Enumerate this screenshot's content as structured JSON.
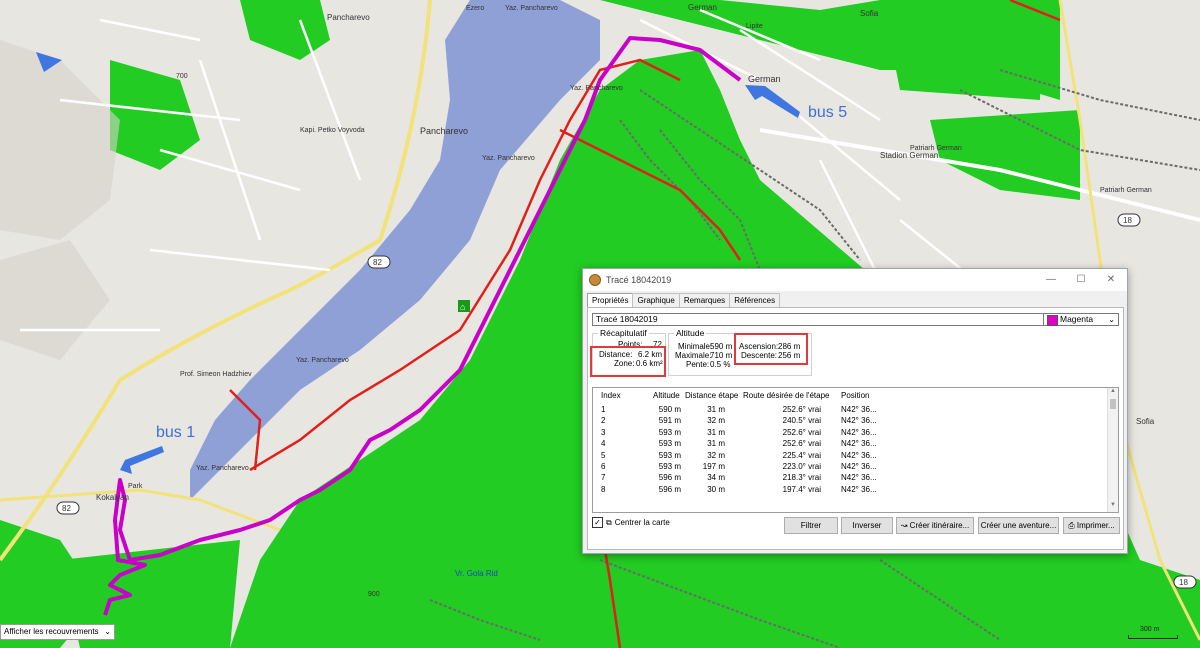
{
  "map": {
    "place_labels": [
      "German",
      "German",
      "Sofia",
      "Sofia",
      "Pancharevo",
      "Pancharevo",
      "Stadion German",
      "Vr. Gola Rid",
      "Kokalyan",
      "Park",
      "Lipite",
      "Yaz. Pancharevo",
      "Yaz. Pancharevo",
      "Yaz. Pancharevo",
      "Yaz. Pancharevo",
      "Yaz. Pancharevo",
      "Patriarh German",
      "Patriarh German",
      "Kapi. Petko Voyvoda",
      "Ezero",
      "Prof. Simeon Hadzhiev"
    ],
    "road_numbers": [
      "82",
      "82",
      "18",
      "18"
    ],
    "bus_labels": [
      "bus 5",
      "bus 1"
    ],
    "contour_labels": [
      "700",
      "900"
    ],
    "scale_label": "300 m",
    "overlay_select": "Afficher les recouvrements",
    "colors": {
      "land": "#e8e6e1",
      "forest": "#22cc22",
      "water": "#8fa0d6",
      "track": "#c800c8",
      "path_red": "#e0201a",
      "bus_arrow": "#3f76e0"
    }
  },
  "dialog": {
    "title": "Tracé 18042019",
    "tabs": [
      "Propriétés",
      "Graphique",
      "Remarques",
      "Références"
    ],
    "active_tab": "Propriétés",
    "name_value": "Tracé 18042019",
    "color_value": "Magenta",
    "recap": {
      "title": "Récapitulatif",
      "points_label": "Points:",
      "points_value": "72",
      "distance_label": "Distance:",
      "distance_value": "6.2 km",
      "zone_label": "Zone:",
      "zone_value": "0.6 km²"
    },
    "altitude": {
      "title": "Altitude",
      "min_label": "Minimale:",
      "min_value": "590 m",
      "max_label": "Maximale:",
      "max_value": "710 m",
      "slope_label": "Pente:",
      "slope_value": "0.5 %",
      "ascent_label": "Ascension:",
      "ascent_value": "286 m",
      "descent_label": "Descente:",
      "descent_value": "256 m"
    },
    "table": {
      "headers": [
        "Index",
        "Altitude",
        "Distance étape",
        "Route désirée de l'étape",
        "Position"
      ],
      "rows": [
        [
          "1",
          "590 m",
          "31 m",
          "252.6° vrai",
          "N42° 36..."
        ],
        [
          "2",
          "591 m",
          "32 m",
          "240.5° vrai",
          "N42° 36..."
        ],
        [
          "3",
          "593 m",
          "31 m",
          "252.6° vrai",
          "N42° 36..."
        ],
        [
          "4",
          "593 m",
          "31 m",
          "252.6° vrai",
          "N42° 36..."
        ],
        [
          "5",
          "593 m",
          "32 m",
          "225.4° vrai",
          "N42° 36..."
        ],
        [
          "6",
          "593 m",
          "197 m",
          "223.0° vrai",
          "N42° 36..."
        ],
        [
          "7",
          "596 m",
          "34 m",
          "218.3° vrai",
          "N42° 36..."
        ],
        [
          "8",
          "596 m",
          "30 m",
          "197.4° vrai",
          "N42° 36..."
        ]
      ]
    },
    "center_map_label": "Centrer la carte",
    "buttons": {
      "filter": "Filtrer",
      "invert": "Inverser",
      "create_route": "Créer itinéraire...",
      "create_adventure": "Créer une aventure...",
      "print": "Imprimer..."
    }
  }
}
